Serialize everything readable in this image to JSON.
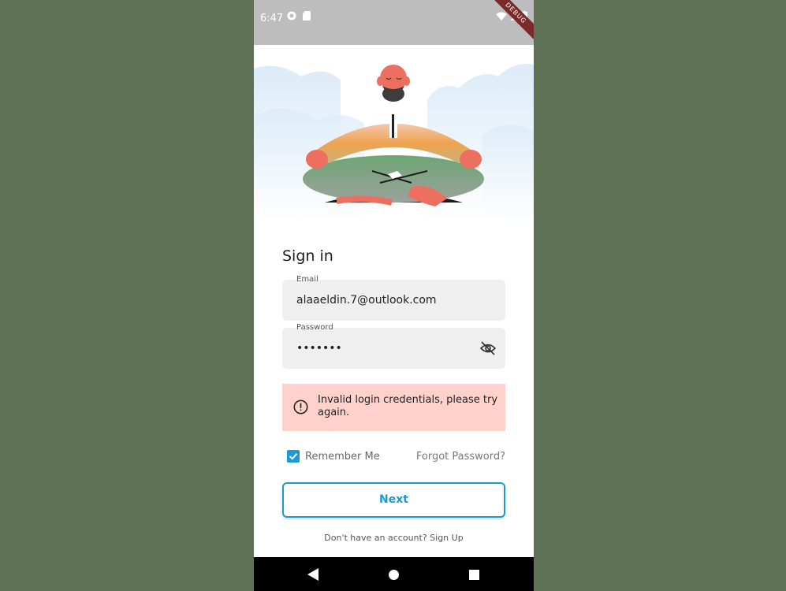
{
  "status_bar": {
    "time": "6:47",
    "debug_label": "DEBUG"
  },
  "form": {
    "title": "Sign in",
    "email": {
      "label": "Email",
      "value": "alaaeldin.7@outlook.com"
    },
    "password": {
      "label": "Password",
      "value": "•••••••"
    },
    "error_message": "Invalid login credentials, please try again.",
    "remember_me": {
      "label": "Remember Me",
      "checked": true
    },
    "forgot_password": "Forgot Password?",
    "next_button": "Next",
    "signup_prompt": "Don't have an account? Sign Up"
  },
  "colors": {
    "accent": "#1a9ad6",
    "error_bg": "#ffd1cb",
    "background": "#5f7256"
  }
}
